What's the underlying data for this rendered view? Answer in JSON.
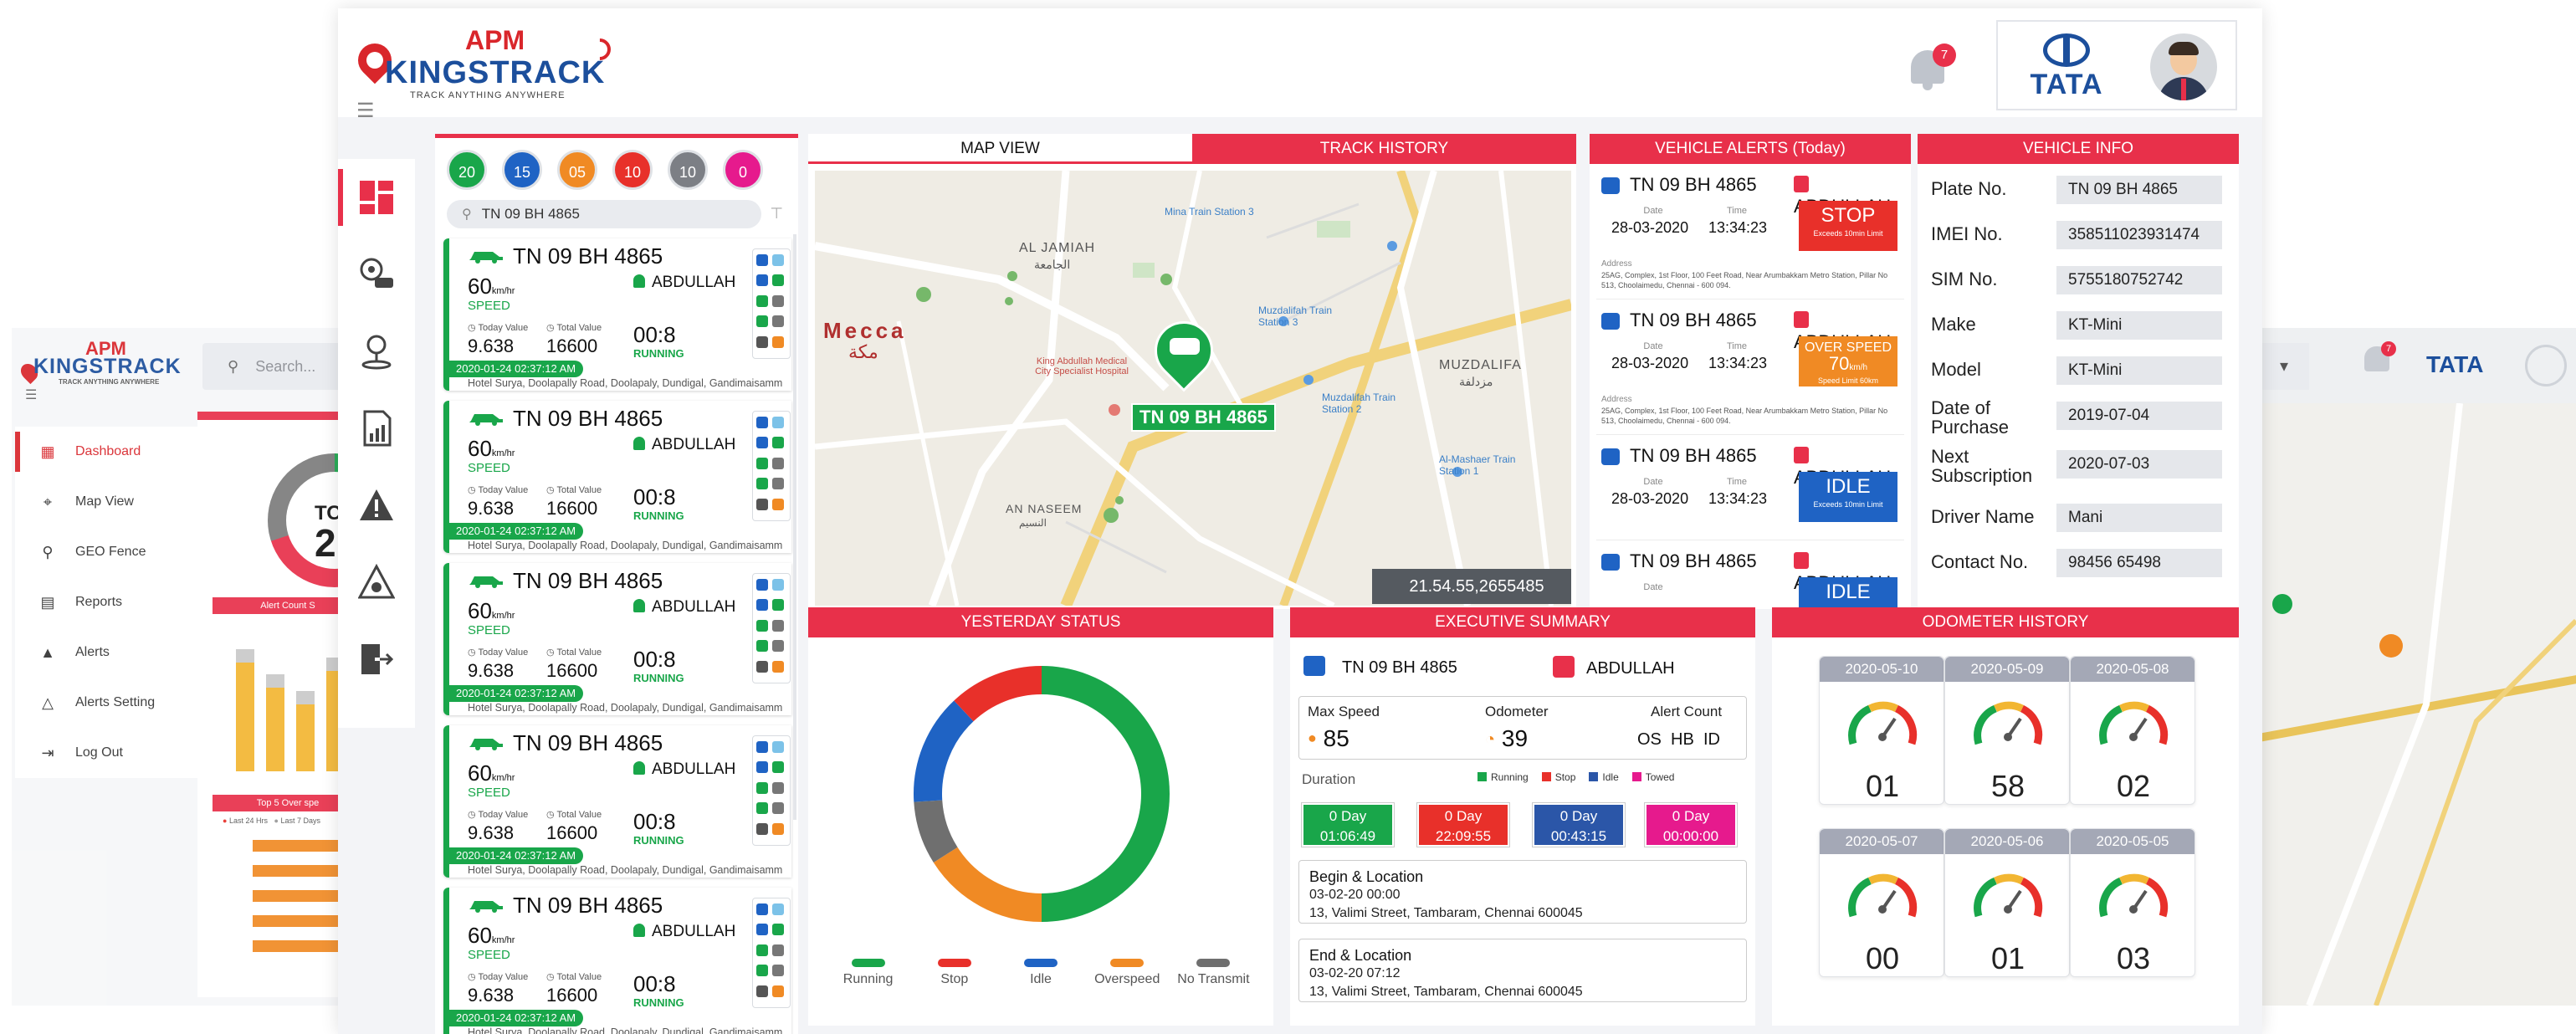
{
  "brand": {
    "apm": "APM",
    "name": "KINGSTRACK",
    "tagline": "TRACK ANYTHING ANYWHERE",
    "partner": "TATA"
  },
  "notifications": {
    "count": "7"
  },
  "colors": {
    "accent": "#e8304a",
    "running": "#19a64a",
    "stop": "#e8302a",
    "idle": "#1f63c4",
    "overspeed": "#f08a24",
    "no_transmit": "#6f6f6f",
    "towed": "#e61a8d"
  },
  "bg_left": {
    "search_placeholder": "Search...",
    "menu": [
      {
        "label": "Dashboard",
        "icon": "dashboard-icon",
        "active": true
      },
      {
        "label": "Map View",
        "icon": "map-view-icon"
      },
      {
        "label": "GEO Fence",
        "icon": "geofence-icon"
      },
      {
        "label": "Reports",
        "icon": "reports-icon"
      },
      {
        "label": "Alerts",
        "icon": "alerts-icon"
      },
      {
        "label": "Alerts Setting",
        "icon": "alerts-setting-icon"
      },
      {
        "label": "Log Out",
        "icon": "logout-icon"
      }
    ],
    "total_label": "TOT",
    "total_value": "2",
    "alert_count_title": "Alert Count S",
    "top5_title": "Top 5 Over spe",
    "last24": "Last 24 Hrs",
    "last7": "Last 7 Days"
  },
  "bg_right": {
    "tata": "TATA",
    "count": "7"
  },
  "filters": [
    {
      "value": "20",
      "color": "#19a64a"
    },
    {
      "value": "15",
      "color": "#1f63c4"
    },
    {
      "value": "05",
      "color": "#f08a24"
    },
    {
      "value": "10",
      "color": "#e8302a"
    },
    {
      "value": "10",
      "color": "#7c7f85"
    },
    {
      "value": "0",
      "color": "#e61a8d"
    }
  ],
  "search": {
    "value": "TN 09 BH 4865"
  },
  "vehicles": [
    {
      "plate": "TN 09 BH 4865",
      "speed": "60",
      "unit": "km/hr",
      "speed_label": "SPEED",
      "driver": "ABDULLAH",
      "today_label": "Today Value",
      "total_label": "Total Value",
      "today": "9.638",
      "total": "16600",
      "duration": "00:8",
      "status": "RUNNING",
      "timestamp": "2020-01-24  02:37:12 AM",
      "address": "Hotel Surya, Doolapally Road, Doolapaly, Dundigal, Gandimaisamm"
    },
    {
      "plate": "TN 09 BH 4865",
      "speed": "60",
      "unit": "km/hr",
      "speed_label": "SPEED",
      "driver": "ABDULLAH",
      "today_label": "Today Value",
      "total_label": "Total Value",
      "today": "9.638",
      "total": "16600",
      "duration": "00:8",
      "status": "RUNNING",
      "timestamp": "2020-01-24  02:37:12 AM",
      "address": "Hotel Surya, Doolapally Road, Doolapaly, Dundigal, Gandimaisamm"
    },
    {
      "plate": "TN 09 BH 4865",
      "speed": "60",
      "unit": "km/hr",
      "speed_label": "SPEED",
      "driver": "ABDULLAH",
      "today_label": "Today Value",
      "total_label": "Total Value",
      "today": "9.638",
      "total": "16600",
      "duration": "00:8",
      "status": "RUNNING",
      "timestamp": "2020-01-24  02:37:12 AM",
      "address": "Hotel Surya, Doolapally Road, Doolapaly, Dundigal, Gandimaisamm"
    },
    {
      "plate": "TN 09 BH 4865",
      "speed": "60",
      "unit": "km/hr",
      "speed_label": "SPEED",
      "driver": "ABDULLAH",
      "today_label": "Today Value",
      "total_label": "Total Value",
      "today": "9.638",
      "total": "16600",
      "duration": "00:8",
      "status": "RUNNING",
      "timestamp": "2020-01-24  02:37:12 AM",
      "address": "Hotel Surya, Doolapally Road, Doolapaly, Dundigal, Gandimaisamm"
    },
    {
      "plate": "TN 09 BH 4865",
      "speed": "60",
      "unit": "km/hr",
      "speed_label": "SPEED",
      "driver": "ABDULLAH",
      "today_label": "Today Value",
      "total_label": "Total Value",
      "today": "9.638",
      "total": "16600",
      "duration": "00:8",
      "status": "RUNNING",
      "timestamp": "2020-01-24  02:37:12 AM",
      "address": "Hotel Surya, Doolapally Road, Doolapaly, Dundigal, Gandimaisamm"
    }
  ],
  "map": {
    "tab_map": "MAP VIEW",
    "tab_history": "TRACK HISTORY",
    "vehicle_label": "TN 09 BH 4865",
    "coordinates": "21.54.55,2655485",
    "places": {
      "mecca": "Mecca",
      "mecca_ar": "مكة",
      "al_jamiah": "AL JAMIAH",
      "al_jamiah_ar": "الجامعة",
      "muzdalifa": "MUZDALIFA",
      "muzdalifa_ar": "مزدلفة",
      "an_naseem": "AN NASEEM",
      "an_naseem_ar": "النسيم",
      "hospital": "King Abdullah Medical City Specialist Hospital",
      "mina_station": "Mina Train Station 3",
      "muz_station": "Muzdalifah Train Station 3",
      "muz_station2": "Muzdalifah Train Station 2",
      "mashaer": "Al-Mashaer Train Station 1"
    }
  },
  "alerts": {
    "title": "VEHICLE ALERTS (Today)",
    "date_label": "Date",
    "time_label": "Time",
    "address_label": "Address",
    "items": [
      {
        "plate": "TN 09 BH 4865",
        "driver": "ABDULLAH",
        "date": "28-03-2020",
        "time": "13:34:23",
        "alert": "STOP",
        "sub": "Exceeds 10min Limit",
        "color": "#e8302a",
        "address": "25AG, Complex, 1st Floor, 100 Feet Road, Near Arumbakkam Metro Station, Pillar No 513, Choolaimedu, Chennai - 600 094."
      },
      {
        "plate": "TN 09 BH 4865",
        "driver": "ABDULLAH",
        "date": "28-03-2020",
        "time": "13:34:23",
        "alert": "OVER SPEED",
        "alert2": "70",
        "unit": "km/h",
        "sub": "Speed Limit 60km",
        "color": "#f08a24",
        "address": "25AG, Complex, 1st Floor, 100 Feet Road, Near Arumbakkam Metro Station, Pillar No 513, Choolaimedu, Chennai - 600 094."
      },
      {
        "plate": "TN 09 BH 4865",
        "driver": "ABDULLAH",
        "date": "28-03-2020",
        "time": "13:34:23",
        "alert": "IDLE",
        "sub": "Exceeds 10min Limit",
        "color": "#1f63c4"
      },
      {
        "plate": "TN 09 BH 4865",
        "driver": "ABDULLAH",
        "date": "Date",
        "alert": "IDLE",
        "color": "#1f63c4"
      }
    ]
  },
  "info": {
    "title": "VEHICLE INFO",
    "rows": [
      {
        "label": "Plate No.",
        "value": "TN 09 BH 4865"
      },
      {
        "label": "IMEI No.",
        "value": "358511023931474"
      },
      {
        "label": "SIM No.",
        "value": "5755180752742"
      },
      {
        "label": "Make",
        "value": "KT-Mini"
      },
      {
        "label": "Model",
        "value": "KT-Mini"
      },
      {
        "label": "Date of Purchase",
        "value": "2019-07-04"
      },
      {
        "label": "Next Subscription",
        "value": "2020-07-03"
      },
      {
        "label": "Driver Name",
        "value": "Mani"
      },
      {
        "label": "Contact No.",
        "value": "98456 65498"
      }
    ]
  },
  "yesterday": {
    "title": "YESTERDAY STATUS",
    "legend": [
      "Running",
      "Stop",
      "Idle",
      "Overspeed",
      "No Transmit"
    ],
    "shares": [
      0.5,
      0.12,
      0.14,
      0.16,
      0.08
    ]
  },
  "exec": {
    "title": "EXECUTIVE SUMMARY",
    "plate": "TN 09 BH 4865",
    "driver": "ABDULLAH",
    "max_speed_label": "Max Speed",
    "max_speed": "85",
    "odometer_label": "Odometer",
    "odometer": "39",
    "alert_count_label": "Alert Count",
    "os": "OS",
    "hb": "HB",
    "id": "ID",
    "duration_label": "Duration",
    "legend": [
      "Running",
      "Stop",
      "Idle",
      "Towed"
    ],
    "durations": [
      {
        "day": "0 Day",
        "time": "01:06:49",
        "color": "#19a64a"
      },
      {
        "day": "0 Day",
        "time": "22:09:55",
        "color": "#e8302a"
      },
      {
        "day": "0 Day",
        "time": "00:43:15",
        "color": "#2b56a8"
      },
      {
        "day": "0 Day",
        "time": "00:00:00",
        "color": "#e61a8d"
      }
    ],
    "begin_title": "Begin & Location",
    "begin_time": "03-02-20 00:00",
    "begin_addr": "13, Valimi Street, Tambaram, Chennai 600045",
    "end_title": "End & Location",
    "end_time": "03-02-20 07:12",
    "end_addr": "13, Valimi Street, Tambaram, Chennai 600045"
  },
  "odometer": {
    "title": "ODOMETER HISTORY",
    "items": [
      {
        "date": "2020-05-10",
        "value": "01"
      },
      {
        "date": "2020-05-09",
        "value": "58"
      },
      {
        "date": "2020-05-08",
        "value": "02"
      },
      {
        "date": "2020-05-07",
        "value": "00"
      },
      {
        "date": "2020-05-06",
        "value": "01"
      },
      {
        "date": "2020-05-05",
        "value": "03"
      }
    ]
  }
}
